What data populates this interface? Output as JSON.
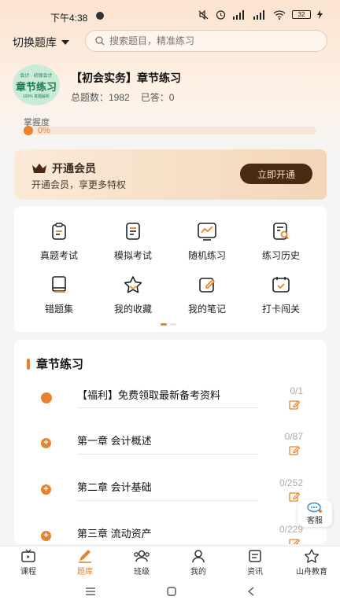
{
  "status": {
    "time": "下午4:38",
    "battery": "32"
  },
  "header": {
    "switch_bank": "切换题库",
    "search_placeholder": "搜索题目，精准练习"
  },
  "course": {
    "logo_top": "会计 · 初级会计",
    "logo_main": "章节练习",
    "logo_sub": "100% 真题解析",
    "title": "【初会实务】章节练习",
    "total_label": "总题数：1982",
    "answered_label": "已答：0"
  },
  "mastery": {
    "label": "掌握度",
    "percent_text": "0%",
    "value": 0
  },
  "vip": {
    "title": "开通会员",
    "subtitle": "开通会员，享更多特权",
    "button": "立即开通"
  },
  "tools": [
    {
      "label": "真题考试",
      "icon": "clipboard-icon"
    },
    {
      "label": "模拟考试",
      "icon": "document-icon"
    },
    {
      "label": "随机练习",
      "icon": "chart-icon"
    },
    {
      "label": "练习历史",
      "icon": "history-search-icon"
    },
    {
      "label": "错题集",
      "icon": "book-icon"
    },
    {
      "label": "我的收藏",
      "icon": "star-icon"
    },
    {
      "label": "我的笔记",
      "icon": "note-edit-icon"
    },
    {
      "label": "打卡闯关",
      "icon": "calendar-check-icon"
    }
  ],
  "chapters": {
    "title": "章节练习",
    "items": [
      {
        "name": "【福利】免费领取最新备考资料",
        "count": "0/1"
      },
      {
        "name": "第一章 会计概述",
        "count": "0/87"
      },
      {
        "name": "第二章 会计基础",
        "count": "0/252"
      },
      {
        "name": "第三章 流动资产",
        "count": "0/229"
      }
    ]
  },
  "service": {
    "label": "客服"
  },
  "tabbar": [
    {
      "label": "课程",
      "icon": "tv-icon",
      "active": false
    },
    {
      "label": "题库",
      "icon": "pencil-icon",
      "active": true
    },
    {
      "label": "班级",
      "icon": "group-icon",
      "active": false
    },
    {
      "label": "我的",
      "icon": "user-icon",
      "active": false
    },
    {
      "label": "资讯",
      "icon": "news-icon",
      "active": false
    },
    {
      "label": "山舟教育",
      "icon": "star-outline-icon",
      "active": false
    }
  ],
  "colors": {
    "accent": "#e7832f",
    "vip_button": "#4a2a14"
  }
}
